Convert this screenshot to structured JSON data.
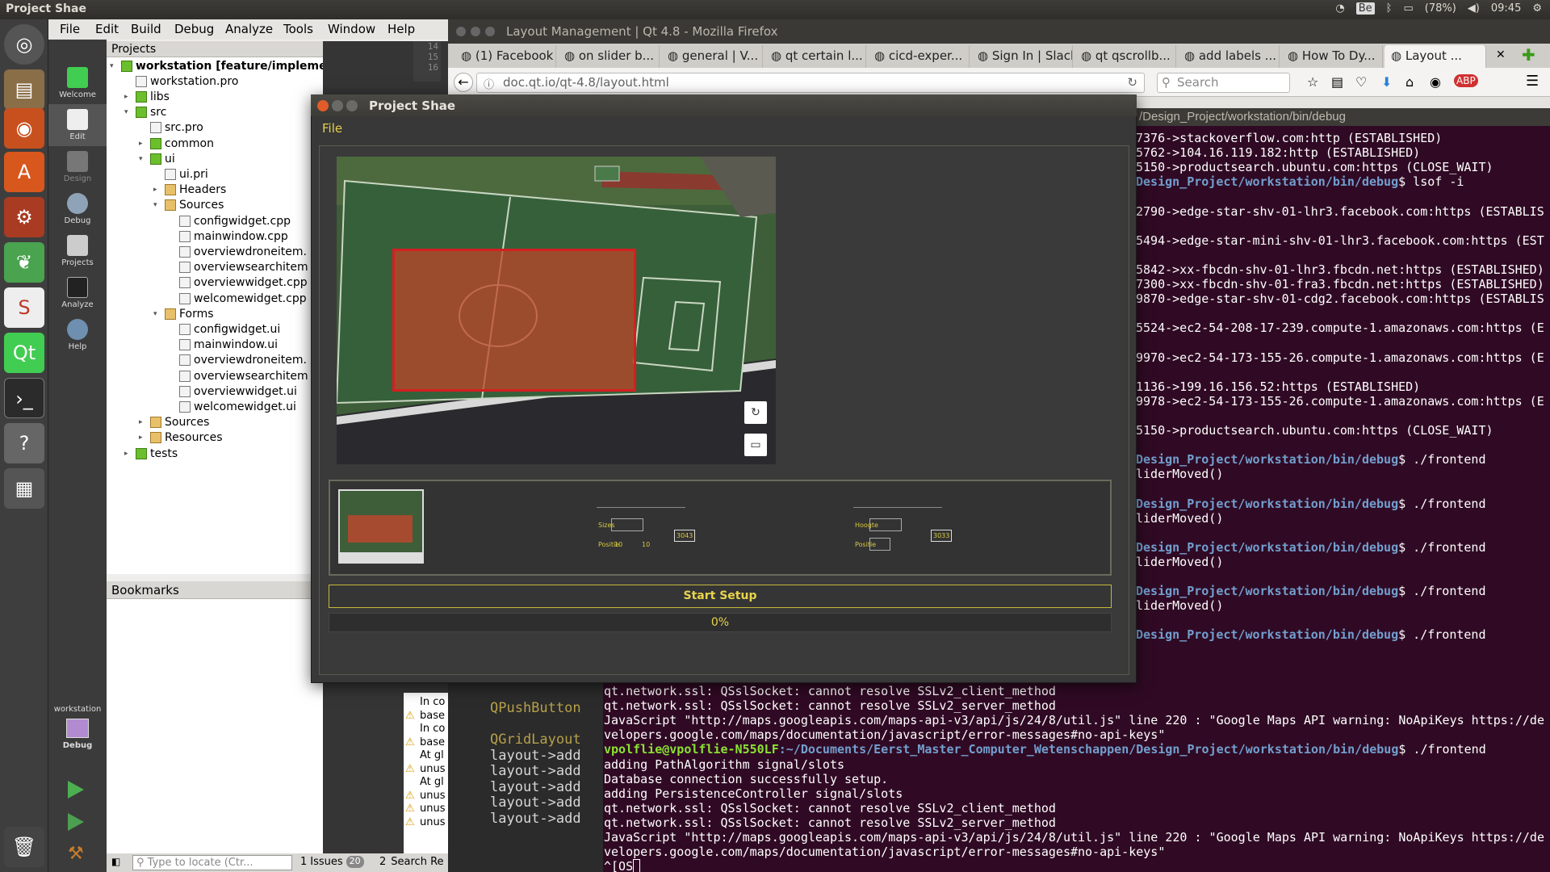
{
  "top_panel": {
    "title": "Project Shae",
    "keyboard": "Be",
    "battery": "(78%)",
    "clock": "09:45"
  },
  "qtcreator": {
    "menu": [
      "File",
      "Edit",
      "Build",
      "Debug",
      "Analyze",
      "Tools",
      "Window",
      "Help"
    ],
    "modes": [
      "Welcome",
      "Edit",
      "Design",
      "Debug",
      "Projects",
      "Analyze",
      "Help"
    ],
    "kit_label": "workstation",
    "kit_mode": "Debug",
    "projects_header": "Projects",
    "tree": [
      {
        "label": "workstation [feature/implementing-welcome-",
        "depth": 0,
        "type": "qt",
        "arrow": "▾",
        "bold": true
      },
      {
        "label": "workstation.pro",
        "depth": 1,
        "type": "file",
        "arrow": ""
      },
      {
        "label": "libs",
        "depth": 1,
        "type": "qt",
        "arrow": "▸"
      },
      {
        "label": "src",
        "depth": 1,
        "type": "qt",
        "arrow": "▾"
      },
      {
        "label": "src.pro",
        "depth": 2,
        "type": "file",
        "arrow": ""
      },
      {
        "label": "common",
        "depth": 2,
        "type": "qt",
        "arrow": "▸"
      },
      {
        "label": "ui",
        "depth": 2,
        "type": "qt",
        "arrow": "▾"
      },
      {
        "label": "ui.pri",
        "depth": 3,
        "type": "file",
        "arrow": ""
      },
      {
        "label": "Headers",
        "depth": 3,
        "type": "folder",
        "arrow": "▸"
      },
      {
        "label": "Sources",
        "depth": 3,
        "type": "folder",
        "arrow": "▾"
      },
      {
        "label": "configwidget.cpp",
        "depth": 4,
        "type": "file",
        "arrow": ""
      },
      {
        "label": "mainwindow.cpp",
        "depth": 4,
        "type": "file",
        "arrow": ""
      },
      {
        "label": "overviewdroneitem.",
        "depth": 4,
        "type": "file",
        "arrow": ""
      },
      {
        "label": "overviewsearchitem",
        "depth": 4,
        "type": "file",
        "arrow": ""
      },
      {
        "label": "overviewwidget.cpp",
        "depth": 4,
        "type": "file",
        "arrow": ""
      },
      {
        "label": "welcomewidget.cpp",
        "depth": 4,
        "type": "file",
        "arrow": ""
      },
      {
        "label": "Forms",
        "depth": 3,
        "type": "folder",
        "arrow": "▾"
      },
      {
        "label": "configwidget.ui",
        "depth": 4,
        "type": "file",
        "arrow": ""
      },
      {
        "label": "mainwindow.ui",
        "depth": 4,
        "type": "file",
        "arrow": ""
      },
      {
        "label": "overviewdroneitem.",
        "depth": 4,
        "type": "file",
        "arrow": ""
      },
      {
        "label": "overviewsearchitem",
        "depth": 4,
        "type": "file",
        "arrow": ""
      },
      {
        "label": "overviewwidget.ui",
        "depth": 4,
        "type": "file",
        "arrow": ""
      },
      {
        "label": "welcomewidget.ui",
        "depth": 4,
        "type": "file",
        "arrow": ""
      },
      {
        "label": "Sources",
        "depth": 2,
        "type": "folder",
        "arrow": "▸"
      },
      {
        "label": "Resources",
        "depth": 2,
        "type": "folder",
        "arrow": "▸"
      },
      {
        "label": "tests",
        "depth": 1,
        "type": "qt",
        "arrow": "▸"
      }
    ],
    "bookmarks_header": "Bookmarks",
    "locate_placeholder": "Type to locate (Ctr...",
    "issues_label": "Issues",
    "issues_count": "20",
    "issues_num": "1",
    "search_num": "2",
    "search_label": "Search Re",
    "issue_rows": [
      "In co",
      "base",
      "In co",
      "base",
      "At gl",
      "unus",
      "At gl",
      "unus",
      "unus",
      "unus"
    ],
    "code_lines": [
      "QPushButton",
      "",
      "QGridLayout",
      "layout->add",
      "layout->add",
      "layout->add",
      "layout->add",
      "layout->add"
    ],
    "line_numbers": [
      "14",
      "15",
      "16"
    ]
  },
  "firefox": {
    "title": "Layout Management | Qt 4.8 - Mozilla Firefox",
    "tabs": [
      "(1) Facebook",
      "on slider b...",
      "general | V...",
      "qt certain l...",
      "cicd-exper...",
      "Sign In | Slack",
      "qt qscrollb...",
      "add labels ...",
      "How To Dy...",
      "Layout ..."
    ],
    "url": "doc.qt.io/qt-4.8/layout.html",
    "search_placeholder": "Search"
  },
  "terminal": {
    "title": "/Design_Project/workstation/bin/debug",
    "upper_lines": [
      {
        "t": "7376->stackoverflow.com:http (ESTABLISHED)"
      },
      {
        "t": "5762->104.16.119.182:http (ESTABLISHED)"
      },
      {
        "t": "5150->productsearch.ubuntu.com:https (CLOSE_WAIT)"
      },
      {
        "p": "Design_Project/workstation/bin/debug",
        "t": "$ lsof -i"
      },
      {
        "t": ""
      },
      {
        "t": "2790->edge-star-shv-01-lhr3.facebook.com:https (ESTABLIS"
      },
      {
        "t": ""
      },
      {
        "t": "5494->edge-star-mini-shv-01-lhr3.facebook.com:https (EST"
      },
      {
        "t": ""
      },
      {
        "t": "5842->xx-fbcdn-shv-01-lhr3.fbcdn.net:https (ESTABLISHED)"
      },
      {
        "t": "7300->xx-fbcdn-shv-01-fra3.fbcdn.net:https (ESTABLISHED)"
      },
      {
        "t": "9870->edge-star-shv-01-cdg2.facebook.com:https (ESTABLIS"
      },
      {
        "t": ""
      },
      {
        "t": "5524->ec2-54-208-17-239.compute-1.amazonaws.com:https (E"
      },
      {
        "t": ""
      },
      {
        "t": "9970->ec2-54-173-155-26.compute-1.amazonaws.com:https (E"
      },
      {
        "t": ""
      },
      {
        "t": "1136->199.16.156.52:https (ESTABLISHED)"
      },
      {
        "t": "9978->ec2-54-173-155-26.compute-1.amazonaws.com:https (E"
      },
      {
        "t": ""
      },
      {
        "t": "5150->productsearch.ubuntu.com:https (CLOSE_WAIT)"
      },
      {
        "t": ""
      },
      {
        "p": "Design_Project/workstation/bin/debug",
        "t": "$ ./frontend"
      },
      {
        "t": "liderMoved()"
      },
      {
        "t": ""
      },
      {
        "p": "Design_Project/workstation/bin/debug",
        "t": "$ ./frontend"
      },
      {
        "t": "liderMoved()"
      },
      {
        "t": ""
      },
      {
        "p": "Design_Project/workstation/bin/debug",
        "t": "$ ./frontend"
      },
      {
        "t": "liderMoved()"
      },
      {
        "t": ""
      },
      {
        "p": "Design_Project/workstation/bin/debug",
        "t": "$ ./frontend"
      },
      {
        "t": "liderMoved()"
      },
      {
        "t": ""
      },
      {
        "p": "Design_Project/workstation/bin/debug",
        "t": "$ ./frontend"
      }
    ],
    "lower_lines": [
      {
        "t": "qt.network.ssl: QSslSocket: cannot resolve SSLv2_client_method"
      },
      {
        "t": "qt.network.ssl: QSslSocket: cannot resolve SSLv2_server_method"
      },
      {
        "t": "JavaScript \"http://maps.googleapis.com/maps-api-v3/api/js/24/8/util.js\" line 220 : \"Google Maps API warning: NoApiKeys https://de"
      },
      {
        "t": "velopers.google.com/maps/documentation/javascript/error-messages#no-api-keys\""
      },
      {
        "u": "vpolflie@vpolflie-N550LF",
        "p": ":~/Documents/Eerst_Master_Computer_Wetenschappen/Design_Project/workstation/bin/debug",
        "t": "$ ./frontend"
      },
      {
        "t": "adding PathAlgorithm signal/slots"
      },
      {
        "t": "Database connection successfully setup."
      },
      {
        "t": "adding PersistenceController signal/slots"
      },
      {
        "t": "qt.network.ssl: QSslSocket: cannot resolve SSLv2_client_method"
      },
      {
        "t": "qt.network.ssl: QSslSocket: cannot resolve SSLv2_server_method"
      },
      {
        "t": "JavaScript \"http://maps.googleapis.com/maps-api-v3/api/js/24/8/util.js\" line 220 : \"Google Maps API warning: NoApiKeys https://de"
      },
      {
        "t": "velopers.google.com/maps/documentation/javascript/error-messages#no-api-keys\""
      },
      {
        "t": "^[OS"
      }
    ]
  },
  "app": {
    "title": "Project Shae",
    "menu_file": "File",
    "start_button": "Start Setup",
    "progress_text": "0%",
    "progress_value": 0,
    "thumb_labels": {
      "t2a": "Sizes",
      "t2b": "Positie",
      "t2c": "10",
      "t2d": "10",
      "t2e": "3043",
      "t3a": "Hoogte",
      "t3b": "Positie",
      "t3c": "3033"
    }
  },
  "colors": {
    "accent": "#e8d54b",
    "selection_red": "#d41f1f",
    "terminal_bg": "#300a24",
    "prompt_green": "#8ae234",
    "prompt_blue": "#729fcf"
  }
}
